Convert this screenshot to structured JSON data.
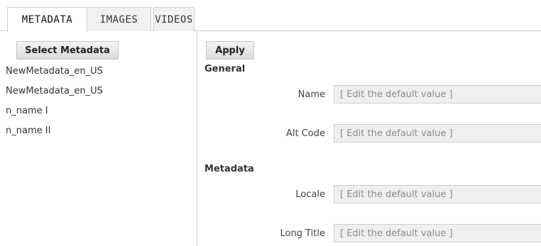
{
  "tabs": [
    {
      "label": "METADATA",
      "active": true
    },
    {
      "label": "IMAGES",
      "active": false
    },
    {
      "label": "VIDEOS",
      "active": false
    }
  ],
  "left_panel": {
    "select_button": "Select Metadata",
    "items": [
      "NewMetadata_en_US",
      "NewMetadata_en_US",
      "n_name I",
      "n_name II"
    ]
  },
  "right_panel": {
    "apply_button": "Apply",
    "sections": [
      {
        "title": "General",
        "fields": [
          {
            "label": "Name",
            "placeholder": "[ Edit the default value ]"
          },
          {
            "label": "Alt Code",
            "placeholder": "[ Edit the default value ]"
          }
        ]
      },
      {
        "title": "Metadata",
        "fields": [
          {
            "label": "Locale",
            "placeholder": "[ Edit the default value ]"
          },
          {
            "label": "Long Title",
            "placeholder": "[ Edit the default value ]"
          }
        ]
      }
    ]
  }
}
